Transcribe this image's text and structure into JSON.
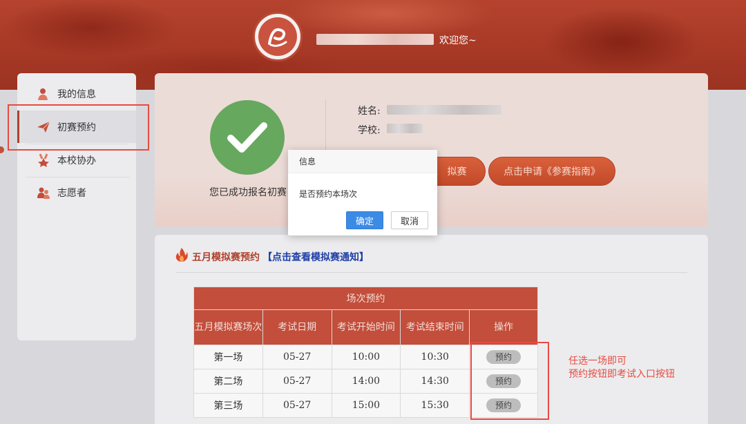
{
  "header": {
    "welcome": "欢迎您~"
  },
  "sidebar": {
    "items": [
      {
        "label": "我的信息",
        "icon": "user-icon"
      },
      {
        "label": "初赛预约",
        "icon": "paper-plane-icon"
      },
      {
        "label": "本校协办",
        "icon": "medal-icon"
      },
      {
        "label": "志愿者",
        "icon": "users-icon"
      }
    ],
    "active_index": 1
  },
  "profile": {
    "success_text": "您已成功报名初赛",
    "name_label": "姓名:",
    "school_label": "学校:",
    "btn_mock": "拟赛",
    "btn_guide": "点击申请《参赛指南》"
  },
  "dialog": {
    "title": "信息",
    "message": "是否预约本场次",
    "ok": "确定",
    "cancel": "取消"
  },
  "section": {
    "title": "五月模拟赛预约",
    "link": "【点击查看模拟赛通知】"
  },
  "table": {
    "caption": "场次预约",
    "headers": [
      "五月模拟赛场次",
      "考试日期",
      "考试开始时间",
      "考试结束时间",
      "操作"
    ],
    "rows": [
      {
        "session": "第一场",
        "date": "05-27",
        "start": "10:00",
        "end": "10:30",
        "action": "预约"
      },
      {
        "session": "第二场",
        "date": "05-27",
        "start": "14:00",
        "end": "14:30",
        "action": "预约"
      },
      {
        "session": "第三场",
        "date": "05-27",
        "start": "15:00",
        "end": "15:30",
        "action": "预约"
      }
    ]
  },
  "annotation": {
    "line1": "任选一场即可",
    "line2": "预约按钮即考试入口按钮"
  },
  "colors": {
    "brand_red": "#c24e3b",
    "success_green": "#66a85e",
    "link_blue": "#1f3fa6",
    "annot_red": "#e84a40",
    "primary_blue": "#3b8be5"
  }
}
